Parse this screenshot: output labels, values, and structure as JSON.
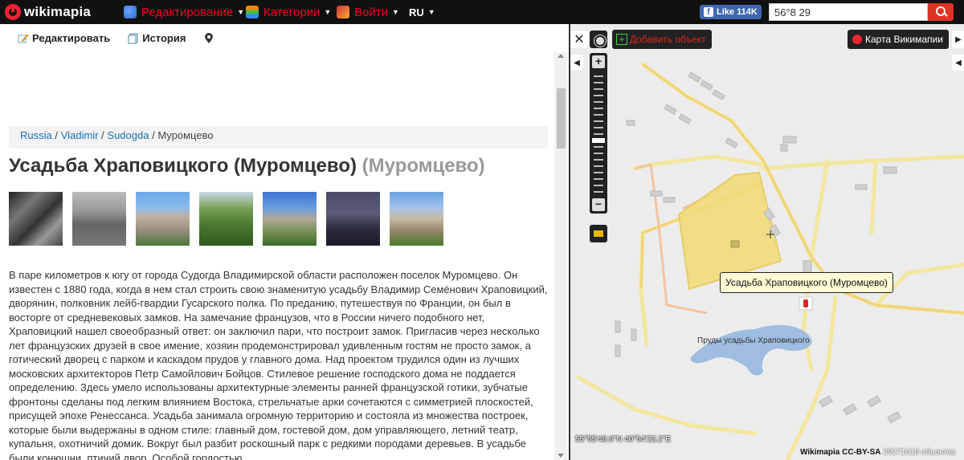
{
  "topbar": {
    "logo_text": "wikimapia",
    "menu": [
      {
        "label": "Редактирование"
      },
      {
        "label": "Категории"
      },
      {
        "label": "Войти"
      }
    ],
    "lang": "RU",
    "fb_label": "Like 114K",
    "search_value": "56°8 29"
  },
  "toolbar": {
    "edit_label": "Редактировать",
    "history_label": "История"
  },
  "breadcrumb": {
    "items": [
      "Russia",
      "Vladimir",
      "Sudogda"
    ],
    "separator": " / ",
    "current": "Муромцево"
  },
  "place": {
    "title": "Усадьба Храповицкого (Муромцево)",
    "alt_title": "(Муромцево)",
    "description": "В паре километров к югу от города Судогда Владимирской области расположен поселок Муромцево. Он известен с 1880 года, когда в нем стал строить свою знаменитую усадьбу Владимир Семёнович Храповицкий, дворянин, полковник лейб-гвардии Гусарского полка. По преданию, путешествуя по Франции, он был в восторге от средневековых замков. На замечание французов, что в России ничего подобного нет, Храповицкий нашел своеобразный ответ: он заключил пари, что построит замок. Пригласив через несколько лет французских друзей в свое имение, хозяин продемонстрировал удивленным гостям не просто замок, а готический дворец с парком и каскадом прудов у главного дома. Над проектом трудился один из лучших московских архитекторов Петр Самойлович Бойцов. Стилевое решение господского дома не поддается определению. Здесь умело использованы архитектурные элементы ранней французской готики, зубчатые фронтоны сделаны под легким влиянием Востока, стрельчатые арки сочетаются с симметрией плоскостей, присущей эпохе Ренессанса. Усадьба занимала огромную территорию и состояла из множества построек, которые были выдержаны в одном стиле: главный дом, гостевой дом, дом управляющего, летний театр, купальня, охотничий домик. Вокруг был разбит роскошный парк с редкими породами деревьев. В усадьбе были конюшни, птичий двор. Особой гордостью"
  },
  "map": {
    "add_object_label": "Добавить объект",
    "map_type_label": "Карта Викимапии",
    "tooltip": "Усадьба Храповицкого (Муромцево)",
    "pond_label": "Пруды усадьбы Храповицкого",
    "coords": "55°55'48.6\"N 40°54'23.2\"E",
    "copyright": "Wikimapia CC-BY-SA",
    "object_count": "29271618 объектов"
  }
}
